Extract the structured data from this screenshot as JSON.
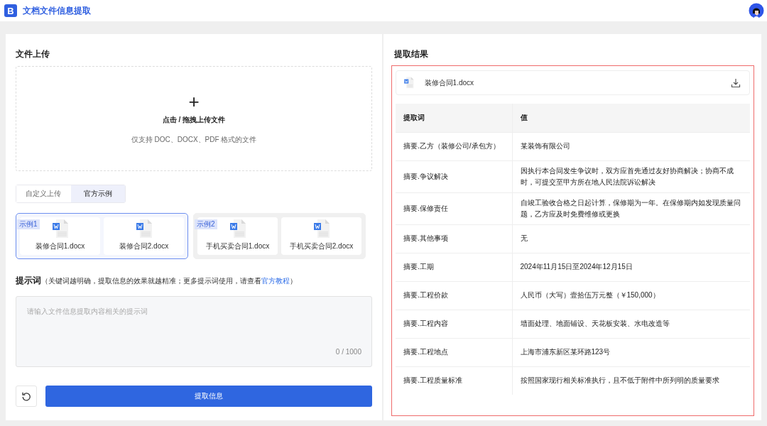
{
  "app": {
    "logo": "B",
    "title": "文档文件信息提取"
  },
  "upload": {
    "heading": "文件上传",
    "plus": "+",
    "action": "点击 / 拖拽上传文件",
    "hint": "仅支持 DOC、DOCX、PDF 格式的文件"
  },
  "tabs": [
    {
      "label": "自定义上传",
      "selected": false
    },
    {
      "label": "官方示例",
      "selected": true
    }
  ],
  "examples": [
    {
      "tag": "示例1",
      "selected": true,
      "files": [
        "装修合同1.docx",
        "装修合同2.docx"
      ]
    },
    {
      "tag": "示例2",
      "selected": false,
      "files": [
        "手机买卖合同1.docx",
        "手机买卖合同2.docx"
      ]
    }
  ],
  "prompt": {
    "label": "提示词",
    "note_before": "（关键词越明确，提取信息的效果就越精准；更多提示词使用，请查看",
    "link": "官方教程",
    "note_after": "）",
    "placeholder": "请输入文件信息提取内容相关的提示词",
    "counter": "0 / 1000"
  },
  "submit": "提取信息",
  "result": {
    "heading": "提取结果",
    "file": "装修合同1.docx",
    "table": {
      "columns": [
        "提取词",
        "值"
      ],
      "rows": [
        [
          "摘要.乙方（装修公司/承包方）",
          "某装饰有限公司"
        ],
        [
          "摘要.争议解决",
          "因执行本合同发生争议时，双方应首先通过友好协商解决；协商不成时，可提交至甲方所在地人民法院诉讼解决"
        ],
        [
          "摘要.保修责任",
          "自竣工验收合格之日起计算，保修期为一年。在保修期内如发现质量问题，乙方应及时免费维修或更换"
        ],
        [
          "摘要.其他事项",
          "无"
        ],
        [
          "摘要.工期",
          "2024年11月15日至2024年12月15日"
        ],
        [
          "摘要.工程价款",
          "人民币（大写）壹拾伍万元整（￥150,000）"
        ],
        [
          "摘要.工程内容",
          "墙面处理、地面铺设、天花板安装、水电改造等"
        ],
        [
          "摘要.工程地点",
          "上海市浦东新区某环路123号"
        ],
        [
          "摘要.工程质量标准",
          "按照国家现行相关标准执行，且不低于附件中所列明的质量要求"
        ]
      ]
    }
  }
}
